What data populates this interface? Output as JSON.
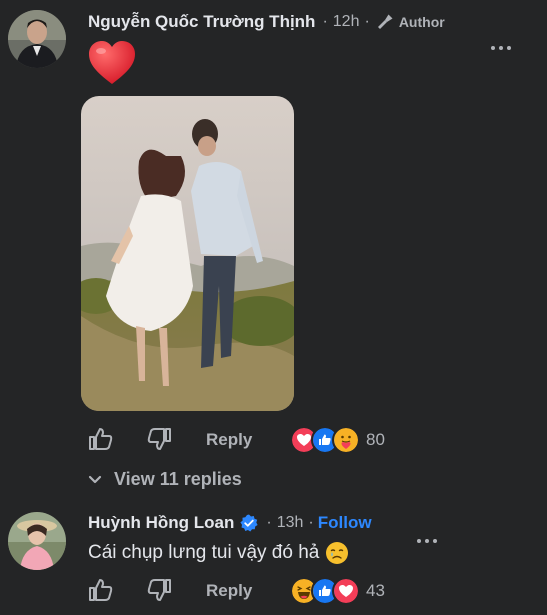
{
  "comments": [
    {
      "author": "Nguyễn Quốc Trường Thịnh",
      "time": "12h",
      "separator": "·",
      "badge": "Author",
      "badge_icon": "microphone-icon",
      "reaction_icons": [
        "heart",
        "like",
        "care"
      ],
      "reaction_count": "80",
      "reply_label": "Reply",
      "view_replies_label": "View 11 replies"
    },
    {
      "author": "Huỳnh Hồng Loan",
      "verified": true,
      "time": "13h",
      "separator": "·",
      "follow_label": "Follow",
      "text": "Cái chụp lưng tui vậy đó hả",
      "text_emoji": "crying-face-icon",
      "reaction_icons": [
        "haha",
        "like",
        "heart"
      ],
      "reaction_count": "43",
      "reply_label": "Reply"
    }
  ],
  "colors": {
    "background": "#242526",
    "text_primary": "#e4e6eb",
    "text_secondary": "#b0b3b8",
    "accent": "#2d88ff",
    "heart": "#f33e58",
    "like": "#1877f2"
  }
}
